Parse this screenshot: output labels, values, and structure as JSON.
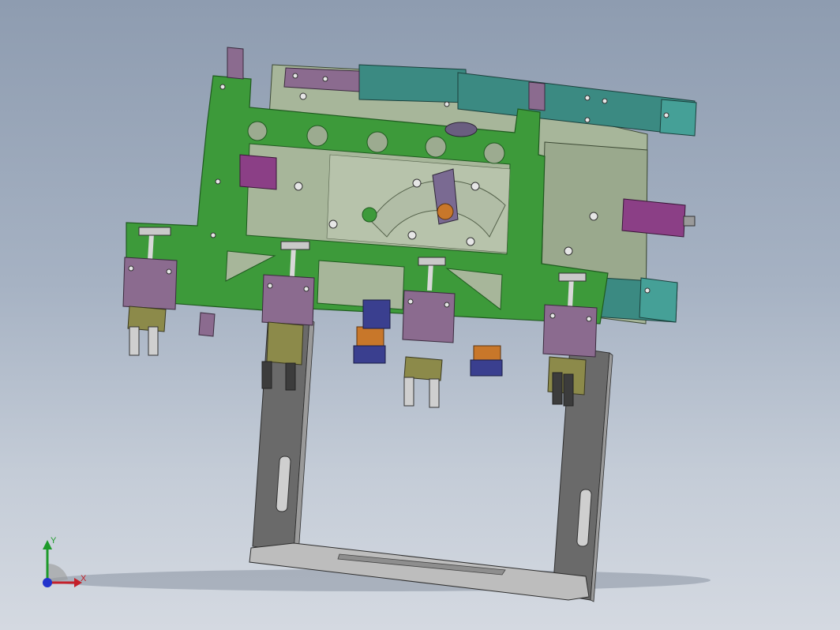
{
  "viewport": {
    "background_top": "#8e9cb0",
    "background_bottom": "#d4d9e1"
  },
  "model": {
    "colors": {
      "main_plate": "#3d9a3a",
      "main_plate_edge": "#1f5a1f",
      "back_plate": "#a7b69a",
      "back_plate_dark": "#7f8f73",
      "rail": "#3b8a82",
      "rail_dark": "#2a645e",
      "bracket": "#8b6b8f",
      "bracket_dark": "#5e4762",
      "cylinder_orange": "#c8772a",
      "cylinder_blue": "#3a3f8f",
      "frame_gray": "#6a6a6a",
      "frame_light": "#9a9a9a",
      "base_light": "#bdbdbd",
      "nozzle_olive": "#8c8a4a",
      "screw": "#e6e6e6"
    }
  },
  "triad": {
    "x_label": "X",
    "y_label": "Y",
    "x_color": "#c4202a",
    "y_color": "#1d9a2a",
    "z_color": "#2233cc",
    "icon": "coordinate-triad-icon"
  }
}
